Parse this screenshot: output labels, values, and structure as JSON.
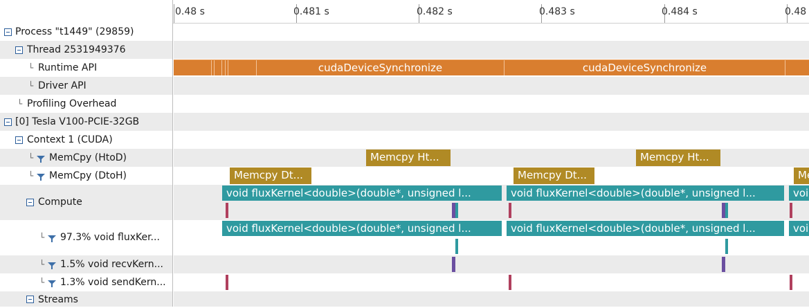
{
  "ruler": {
    "ticks": [
      "0.48 s",
      "0.481 s",
      "0.482 s",
      "0.483 s",
      "0.484 s",
      "0.48"
    ]
  },
  "tree": {
    "process": "Process \"t1449\" (29859)",
    "thread": "Thread 2531949376",
    "runtime_api": "Runtime API",
    "driver_api": "Driver API",
    "profiling_overhead": "Profiling Overhead",
    "device": "[0] Tesla V100-PCIE-32GB",
    "context": "Context 1 (CUDA)",
    "memcpy_htod": "MemCpy (HtoD)",
    "memcpy_dtoh": "MemCpy (DtoH)",
    "compute": "Compute",
    "kernel_flux": "97.3% void fluxKer...",
    "kernel_recv": "1.5% void recvKern...",
    "kernel_send": "1.3% void sendKern...",
    "streams": "Streams"
  },
  "timeline": {
    "runtime_bar_1": "cudaDeviceSynchronize",
    "runtime_bar_2": "cudaDeviceSynchronize",
    "htod_1": "Memcpy Ht...",
    "htod_2": "Memcpy Ht...",
    "dtoh_1": "Memcpy Dt...",
    "dtoh_2": "Memcpy Dt...",
    "dtoh_3": "Me",
    "compute_1": "void fluxKernel<double>(double*, unsigned l...",
    "compute_2": "void fluxKernel<double>(double*, unsigned l...",
    "compute_3": "void",
    "flux_1": "void fluxKernel<double>(double*, unsigned l...",
    "flux_2": "void fluxKernel<double>(double*, unsigned l...",
    "flux_3": "void"
  },
  "colors": {
    "runtime": "#d97e2f",
    "memcpy": "#b08a25",
    "kernel": "#2f9aa0",
    "recv_marker": "#6b4fa0",
    "send_marker": "#b0405e"
  }
}
